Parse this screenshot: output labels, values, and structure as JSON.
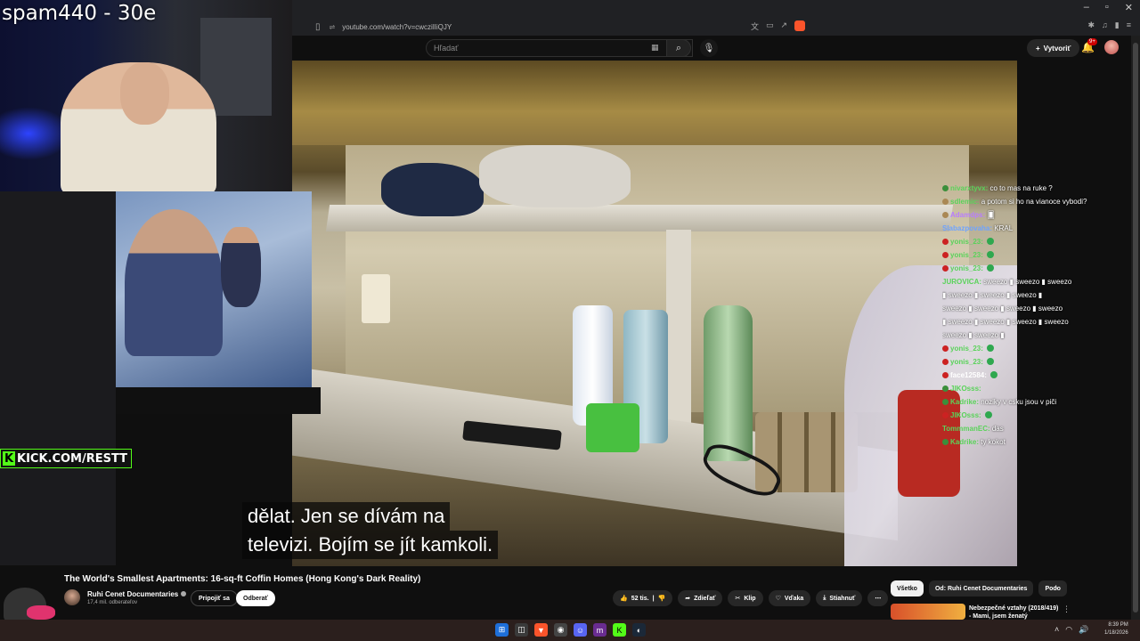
{
  "stream": {
    "overlay_title": "spam440 - 30e",
    "kick_text": "KICK.COM/RESTT"
  },
  "browser": {
    "url": "youtube.com/watch?v=cwczilIiQJY",
    "window_controls": [
      "–",
      "▫",
      "✕"
    ]
  },
  "youtube": {
    "search_placeholder": "Hľadať",
    "create_label": "Vytvoriť",
    "notif_count": "9+"
  },
  "video": {
    "subtitle_lines": [
      "dělat.  Jen se dívám na",
      "televizi.  Bojím se jít kamkoli."
    ],
    "title": "The World's Smallest Apartments: 16-sq-ft Coffin Homes (Hong Kong's Dark Reality)",
    "channel": "Ruhi Cenet Documentaries",
    "subscribers": "17,4 mil. odberateľov",
    "join_label": "Pripojiť sa",
    "subscribe_label": "Odberať",
    "likes": "52 tis.",
    "share_label": "Zdieľať",
    "clip_label": "Klip",
    "thanks_label": "Vďaka",
    "download_label": "Stiahnuť",
    "more_label": "⋯"
  },
  "recommendations": {
    "chips": [
      "Všetko",
      "Od: Ruhi Cenet Documentaries",
      "Podo"
    ],
    "first_title_line1": "Nebezpečné vztahy (2018/419)",
    "first_title_line2": "- Mami, jsem ženatý"
  },
  "chat": [
    {
      "name": "nivarxtyvx",
      "color": "#5ad35a",
      "badge": "#3b8f3b",
      "msg": "co to mas na ruke ?"
    },
    {
      "name": "sdlemic",
      "color": "#5ad35a",
      "badge": "#aa8855",
      "msg": "a potom si ho na vianoce vybodi?"
    },
    {
      "name": "Adamdps",
      "color": "#b87cff",
      "badge": "#aa8855",
      "msg": "🂠"
    },
    {
      "name": "Slabazpovaha",
      "color": "#6ea3ff",
      "badge": "",
      "msg": "KRAL"
    },
    {
      "name": "yonis_23",
      "color": "#5ad35a",
      "badge": "#c22",
      "msg": "",
      "check": true
    },
    {
      "name": "yonis_23",
      "color": "#5ad35a",
      "badge": "#c22",
      "msg": "",
      "check": true
    },
    {
      "name": "yonis_23",
      "color": "#5ad35a",
      "badge": "#c22",
      "msg": "",
      "check": true
    },
    {
      "name": "JUROVICA",
      "color": "#5ad35a",
      "badge": "",
      "msg": "sweezo ▮ sweezo ▮ sweezo"
    },
    {
      "name": "",
      "color": "#fff",
      "badge": "",
      "msg": "▮ sweezo ▮ sweezo ▮ sweezo ▮"
    },
    {
      "name": "",
      "color": "#fff",
      "badge": "",
      "msg": "sweezo ▮ sweezo ▮ sweezo ▮ sweezo"
    },
    {
      "name": "",
      "color": "#fff",
      "badge": "",
      "msg": "▮ sweezo ▮ sweezo ▮ sweezo ▮ sweezo"
    },
    {
      "name": "",
      "color": "#fff",
      "badge": "",
      "msg": "sweezo ▮ sweezo ▮"
    },
    {
      "name": "yonis_23",
      "color": "#5ad35a",
      "badge": "#c22",
      "msg": "",
      "check": true
    },
    {
      "name": "yonis_23",
      "color": "#5ad35a",
      "badge": "#c22",
      "msg": "",
      "check": true
    },
    {
      "name": "face12584",
      "color": "#fff",
      "badge": "#c22",
      "msg": "",
      "check": true
    },
    {
      "name": "JIKOsss",
      "color": "#5ad35a",
      "badge": "#3b8f3b",
      "msg": ""
    },
    {
      "name": "Kadrike",
      "color": "#5ad35a",
      "badge": "#3b8f3b",
      "msg": "noziky v csku jsou v piči"
    },
    {
      "name": "JIKOsss",
      "color": "#5ad35a",
      "badge": "#c22",
      "msg": "",
      "check": true
    },
    {
      "name": "TommmanEC",
      "color": "#5ad35a",
      "badge": "",
      "msg": "das"
    },
    {
      "name": "Kadrike",
      "color": "#5ad35a",
      "badge": "#3b8f3b",
      "msg": "ty kokot"
    }
  ],
  "taskbar": {
    "time": "8:39 PM",
    "date": "1/18/2026"
  },
  "colors": {
    "kick_green": "#53fc18",
    "yt_red": "#cc0000",
    "background": "#0f0f0f"
  }
}
